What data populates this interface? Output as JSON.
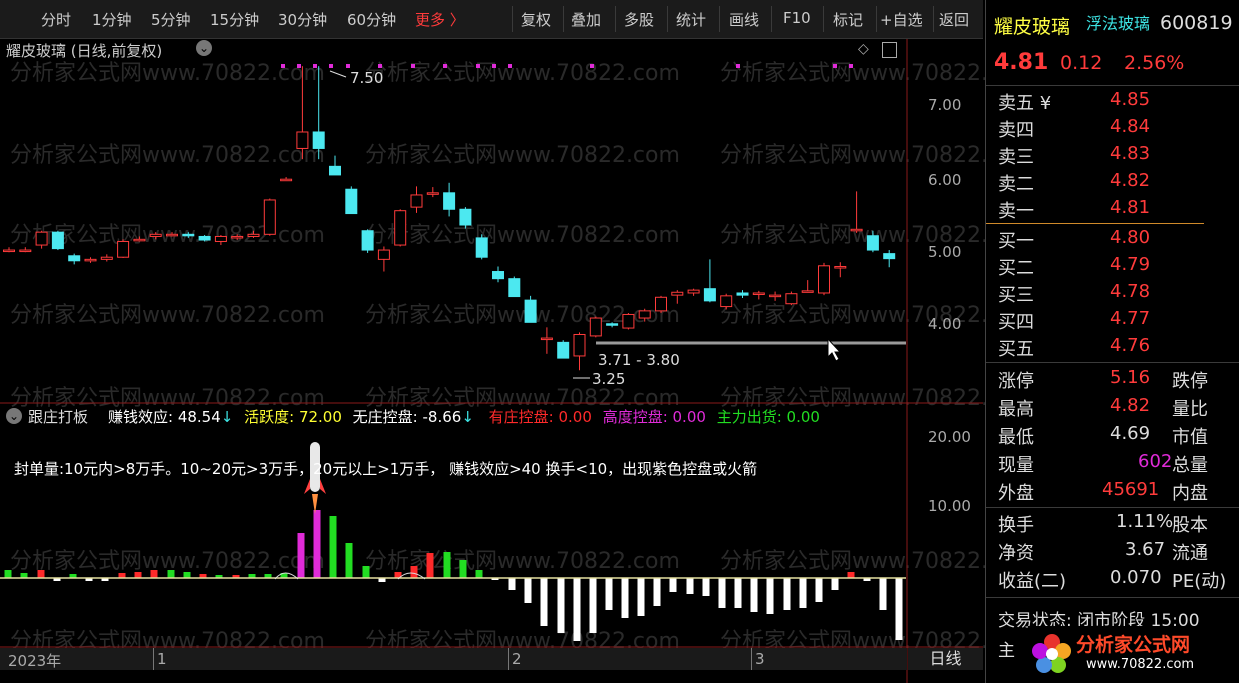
{
  "toolbar": {
    "periods": [
      "分时",
      "1分钟",
      "5分钟",
      "15分钟",
      "30分钟",
      "60分钟"
    ],
    "more": "更多 〉",
    "tools": [
      "复权",
      "叠加",
      "多股",
      "统计",
      "画线",
      "F10",
      "标记",
      "+自选",
      "返回"
    ]
  },
  "chart": {
    "title": "耀皮玻璃 (日线,前复权)",
    "y_ticks": [
      "7.00",
      "6.00",
      "5.00",
      "4.00"
    ],
    "high_label": "7.50",
    "low_label": "3.25",
    "range_label": "3.71 - 3.80",
    "watermark": "分析家公式网www.70822.com",
    "x_labels": [
      "2023年",
      "1",
      "2",
      "3"
    ],
    "period_label": "日线"
  },
  "chart_data": {
    "type": "candlestick",
    "title": "耀皮玻璃 (日线,前复权)",
    "ylim": [
      3.1,
      7.6
    ],
    "annotations": [
      "7.50",
      "3.25",
      "3.71 - 3.80"
    ],
    "candles": [
      [
        4.93,
        4.97,
        4.9,
        4.93
      ],
      [
        4.93,
        4.97,
        4.9,
        4.93
      ],
      [
        5.0,
        5.2,
        4.95,
        5.18
      ],
      [
        5.18,
        5.2,
        4.93,
        4.95
      ],
      [
        4.85,
        4.88,
        4.73,
        4.78
      ],
      [
        4.8,
        4.83,
        4.75,
        4.8
      ],
      [
        4.8,
        4.87,
        4.77,
        4.83
      ],
      [
        4.83,
        5.08,
        4.82,
        5.05
      ],
      [
        5.08,
        5.12,
        5.05,
        5.08
      ],
      [
        5.12,
        5.18,
        5.08,
        5.15
      ],
      [
        5.15,
        5.18,
        5.12,
        5.15
      ],
      [
        5.15,
        5.18,
        5.1,
        5.13
      ],
      [
        5.12,
        5.14,
        5.05,
        5.07
      ],
      [
        5.05,
        5.14,
        5.0,
        5.12
      ],
      [
        5.1,
        5.15,
        5.07,
        5.12
      ],
      [
        5.12,
        5.2,
        5.1,
        5.15
      ],
      [
        5.15,
        5.65,
        5.13,
        5.63
      ],
      [
        5.9,
        5.95,
        5.9,
        5.92
      ],
      [
        6.35,
        7.5,
        6.2,
        6.58
      ],
      [
        6.58,
        7.5,
        6.2,
        6.35
      ],
      [
        6.1,
        6.25,
        5.98,
        5.98
      ],
      [
        5.78,
        5.82,
        5.44,
        5.44
      ],
      [
        5.2,
        5.22,
        4.89,
        4.93
      ],
      [
        4.8,
        4.98,
        4.63,
        4.93
      ],
      [
        5.0,
        5.5,
        4.98,
        5.48
      ],
      [
        5.53,
        5.82,
        5.45,
        5.7
      ],
      [
        5.72,
        5.81,
        5.67,
        5.73
      ],
      [
        5.73,
        5.87,
        5.4,
        5.5
      ],
      [
        5.5,
        5.53,
        5.23,
        5.28
      ],
      [
        5.1,
        5.15,
        4.8,
        4.83
      ],
      [
        4.63,
        4.7,
        4.48,
        4.53
      ],
      [
        4.53,
        4.56,
        4.28,
        4.28
      ],
      [
        4.23,
        4.29,
        3.92,
        3.92
      ],
      [
        3.7,
        3.85,
        3.48,
        3.7
      ],
      [
        3.64,
        3.67,
        3.42,
        3.42
      ],
      [
        3.45,
        3.78,
        3.25,
        3.75
      ],
      [
        3.73,
        4.0,
        3.71,
        3.98
      ],
      [
        3.9,
        3.92,
        3.85,
        3.88
      ],
      [
        3.84,
        4.05,
        3.82,
        4.03
      ],
      [
        3.98,
        4.11,
        3.93,
        4.08
      ],
      [
        4.08,
        4.29,
        4.05,
        4.27
      ],
      [
        4.3,
        4.37,
        4.18,
        4.34
      ],
      [
        4.33,
        4.39,
        4.29,
        4.37
      ],
      [
        4.39,
        4.8,
        4.2,
        4.22
      ],
      [
        4.14,
        4.32,
        4.1,
        4.29
      ],
      [
        4.33,
        4.37,
        4.26,
        4.3
      ],
      [
        4.31,
        4.36,
        4.24,
        4.33
      ],
      [
        4.29,
        4.35,
        4.22,
        4.3
      ],
      [
        4.18,
        4.35,
        4.16,
        4.32
      ],
      [
        4.36,
        4.51,
        4.34,
        4.36
      ],
      [
        4.33,
        4.75,
        4.3,
        4.71
      ],
      [
        4.7,
        4.76,
        4.55,
        4.7
      ],
      [
        5.2,
        5.75,
        5.17,
        5.22
      ],
      [
        5.13,
        5.2,
        4.9,
        4.93
      ],
      [
        4.88,
        4.93,
        4.69,
        4.81
      ]
    ]
  },
  "indicator": {
    "label_name": "跟庄打板",
    "items": [
      {
        "label": "赚钱效应: 48.54",
        "arrow": "↓",
        "color": "#ffffff"
      },
      {
        "label": "活跃度: 72.00",
        "arrow": "",
        "color": "#ffff33"
      },
      {
        "label": "无庄控盘: -8.66",
        "arrow": "↓",
        "color": "#ffffff"
      },
      {
        "label": "有庄控盘: 0.00",
        "arrow": "",
        "color": "#ff2a2a"
      },
      {
        "label": "高度控盘: 0.00",
        "arrow": "",
        "color": "#e02bd8"
      },
      {
        "label": "主力出货: 0.00",
        "arrow": "",
        "color": "#22dd22"
      }
    ],
    "note": "封单量:10元内>8万手。10~20元>3万手，20元以上>1万手， 赚钱效应>40 换手<10，出现紫色控盘或火箭",
    "y_ticks": [
      "20.00",
      "10.00"
    ]
  },
  "quote": {
    "name": "耀皮玻璃",
    "tag": "浮法玻璃",
    "code": "600819",
    "price": "4.81",
    "change": "0.12",
    "pct": "2.56%",
    "asks": [
      {
        "label": "卖五 ¥",
        "price": "4.85"
      },
      {
        "label": "卖四",
        "price": "4.84"
      },
      {
        "label": "卖三",
        "price": "4.83"
      },
      {
        "label": "卖二",
        "price": "4.82"
      },
      {
        "label": "卖一",
        "price": "4.81"
      }
    ],
    "bids": [
      {
        "label": "买一",
        "price": "4.80"
      },
      {
        "label": "买二",
        "price": "4.79"
      },
      {
        "label": "买三",
        "price": "4.78"
      },
      {
        "label": "买四",
        "price": "4.77"
      },
      {
        "label": "买五",
        "price": "4.76"
      }
    ],
    "stats": [
      {
        "label": "涨停",
        "value": "5.16",
        "right": "跌停",
        "vcolor": "#ff3b3b"
      },
      {
        "label": "最高",
        "value": "4.82",
        "right": "量比",
        "vcolor": "#ff3b3b"
      },
      {
        "label": "最低",
        "value": "4.69",
        "right": "市值",
        "vcolor": "#dddddd"
      },
      {
        "label": "现量",
        "value": "602",
        "right": "总量",
        "vcolor": "#e02bd8"
      },
      {
        "label": "外盘",
        "value": "45691",
        "right": "内盘",
        "vcolor": "#ff3b3b"
      }
    ],
    "stats2": [
      {
        "label": "换手",
        "value": "1.11%",
        "right": "股本"
      },
      {
        "label": "净资",
        "value": "3.67",
        "right": "流通"
      },
      {
        "label": "收益(二)",
        "value": "0.070",
        "right": "PE(动)"
      }
    ],
    "status_label": "交易状态: 闭市阶段 15:00",
    "bottom_partial": "主",
    "logo_text": "分析家公式网",
    "logo_url": "www.70822.com"
  }
}
